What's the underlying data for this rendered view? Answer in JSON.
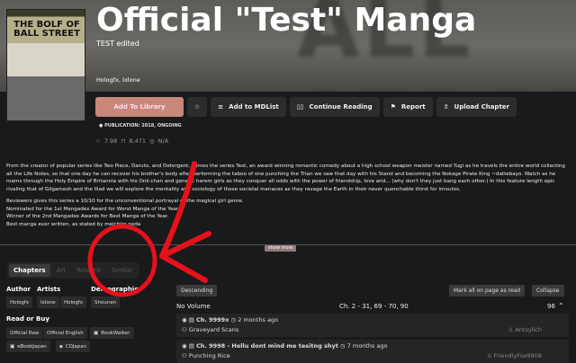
{
  "manga": {
    "title": "Official \"Test\" Manga",
    "alt_title": "TEST edited",
    "authors_line": "Hologfx, Ixlone",
    "cover_text": "THE BOLF OF BALL STREET",
    "banner_text": "ALL STREE"
  },
  "actions": {
    "add_library": "Add To Library",
    "add_mdlist": "Add to MDList",
    "continue": "Continue Reading",
    "report": "Report",
    "upload": "Upload Chapter"
  },
  "publication": "PUBLICATION: 2018, ONGOING",
  "stats": {
    "rating": "7.98",
    "follows": "8,471",
    "views": "N/A"
  },
  "description": [
    "From the creator of popular series like Two Piece, Daruto, and Detergent, comes the series Test, an award winning romantic comedy about a high school weapon meister named Yugi as he travels the entire world collecting all the Life Notes, so that one day he can recover his brother's body after performing the taboo of one punching the Titan we saw that day with his Stand and becoming the Nokage Pirate King ~dattebayo. Watch as he roams through the Holy Empire of Britannia with his Onii-chan and generic harem girls as they conquer all odds with the power of friendship, love and... (why don't they just bang each other.) In this feature length epic rivaling that of Gilgamesh and the Iliad we will explore the mentality and sociology of these societal menaces as they ravage the Earth in their never quenchable thirst for imoutos.",
    "Reviewers gives this series a 10/10 for the unconventional portrayal of the magical girl genre.",
    "Nominated for the 1st Mangadex Award for Worst Manga of the Year.",
    "Winner of the 2nd Mangadex Awards for Best Manga of the Year.",
    "Best manga ever written, as stated by meichiro noda"
  ],
  "show_more": "show more",
  "tabs": [
    "Chapters",
    "Art",
    "Related",
    "Similar"
  ],
  "info": {
    "author_label": "Author",
    "artists_label": "Artists",
    "demographic_label": "Demographic",
    "author": "Hologfx",
    "artists": [
      "Ixlone",
      "Hologfx"
    ],
    "demographic": "Shounen",
    "read_label": "Read or Buy",
    "links": [
      "Official Raw",
      "Official English",
      "BookWalker",
      "eBookJapan",
      "CDJapan"
    ]
  },
  "chapters": {
    "sort": "Descending",
    "mark_read": "Mark all on page as read",
    "collapse": "Collapse",
    "volume": "No Volume",
    "range": "Ch. 2 - 31, 69 - 70, 90",
    "count": "96",
    "items": [
      {
        "title": "Ch. 9999x",
        "time": "2 months ago",
        "group": "Graveyard Scans",
        "user": "Antsylich"
      },
      {
        "title": "Ch. 9998 - Hellu dont mind me tesitng shyt",
        "time": "7 months ago",
        "group": "Punching Rice",
        "user": "FriendlyFox9908"
      }
    ]
  }
}
